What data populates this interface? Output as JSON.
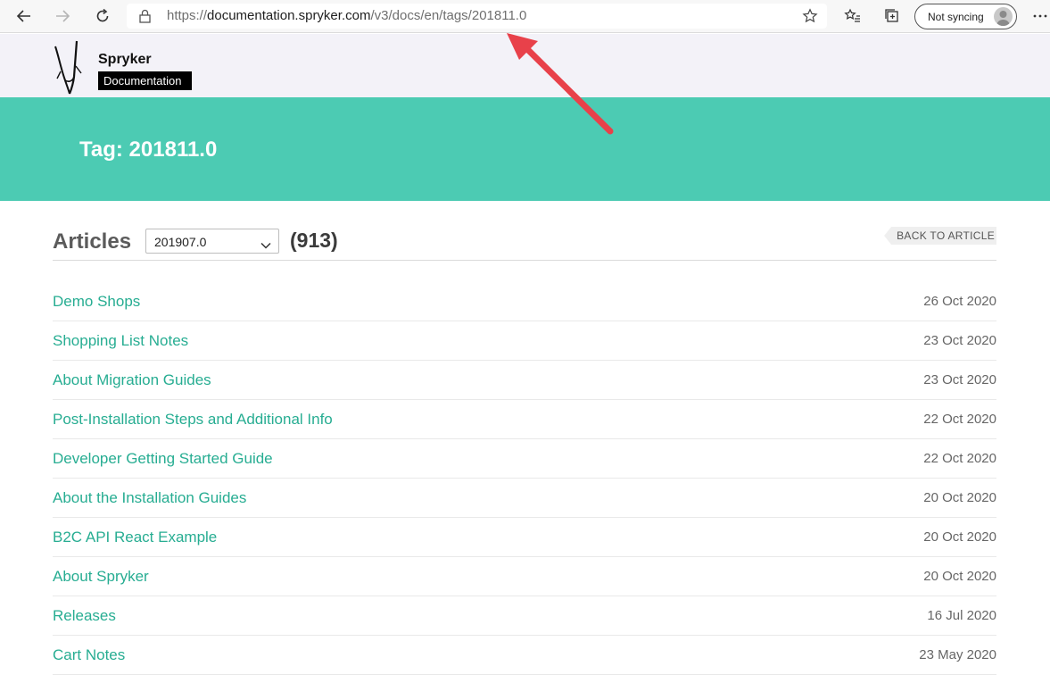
{
  "browser": {
    "url_prefix": "https://",
    "url_host": "documentation.spryker.com",
    "url_path": "/v3/docs/en/tags/201811.0",
    "profile_label": "Not syncing",
    "icons": [
      "back-arrow-icon",
      "forward-arrow-icon",
      "refresh-icon",
      "lock-icon",
      "favorite-star-icon",
      "favorites-list-icon",
      "collections-icon",
      "profile-avatar-icon",
      "more-options-icon"
    ]
  },
  "site": {
    "brand_name": "Spryker",
    "brand_badge": "Documentation",
    "hero_title": "Tag: 201811.0"
  },
  "articles": {
    "heading": "Articles",
    "selected_version": "201907.0",
    "count": "(913)",
    "back_label": "BACK TO ARTICLE",
    "items": [
      {
        "title": "Demo Shops",
        "date": "26 Oct 2020"
      },
      {
        "title": "Shopping List Notes",
        "date": "23 Oct 2020"
      },
      {
        "title": "About Migration Guides",
        "date": "23 Oct 2020"
      },
      {
        "title": "Post-Installation Steps and Additional Info",
        "date": "22 Oct 2020"
      },
      {
        "title": "Developer Getting Started Guide",
        "date": "22 Oct 2020"
      },
      {
        "title": "About the Installation Guides",
        "date": "20 Oct 2020"
      },
      {
        "title": "B2C API React Example",
        "date": "20 Oct 2020"
      },
      {
        "title": "About Spryker",
        "date": "20 Oct 2020"
      },
      {
        "title": "Releases",
        "date": "16 Jul 2020"
      },
      {
        "title": "Cart Notes",
        "date": "23 May 2020"
      }
    ]
  },
  "colors": {
    "accent": "#4ccbb3",
    "link": "#27ad92",
    "annotation_arrow": "#e8414a"
  }
}
